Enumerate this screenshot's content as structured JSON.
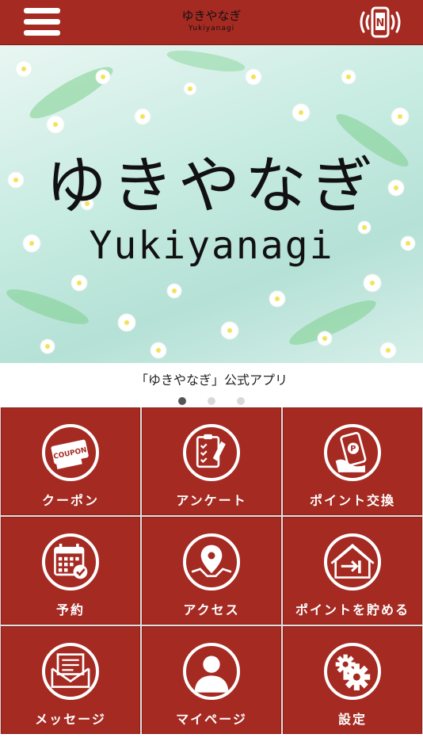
{
  "header": {
    "title": "ゆきやなぎ",
    "subtitle": "Yukiyanagi",
    "menu_icon": "hamburger-menu-icon",
    "nfc_icon": "nfc-phone-icon",
    "bg_color": "#a52a22"
  },
  "banner": {
    "title_jp": "ゆきやなぎ",
    "title_en": "Yukiyanagi"
  },
  "carousel": {
    "caption": "「ゆきやなぎ」公式アプリ",
    "active_index": 0,
    "count": 3
  },
  "menu": {
    "tile_color": "#a52a22",
    "items": [
      {
        "label": "クーポン",
        "icon": "coupon-icon"
      },
      {
        "label": "アンケート",
        "icon": "survey-clipboard-icon"
      },
      {
        "label": "ポイント交換",
        "icon": "point-exchange-icon"
      },
      {
        "label": "予約",
        "icon": "calendar-reservation-icon"
      },
      {
        "label": "アクセス",
        "icon": "map-pin-icon"
      },
      {
        "label": "ポイントを貯める",
        "icon": "checkin-house-icon"
      },
      {
        "label": "メッセージ",
        "icon": "mail-icon"
      },
      {
        "label": "マイページ",
        "icon": "user-icon"
      },
      {
        "label": "設定",
        "icon": "gear-icon"
      }
    ]
  }
}
